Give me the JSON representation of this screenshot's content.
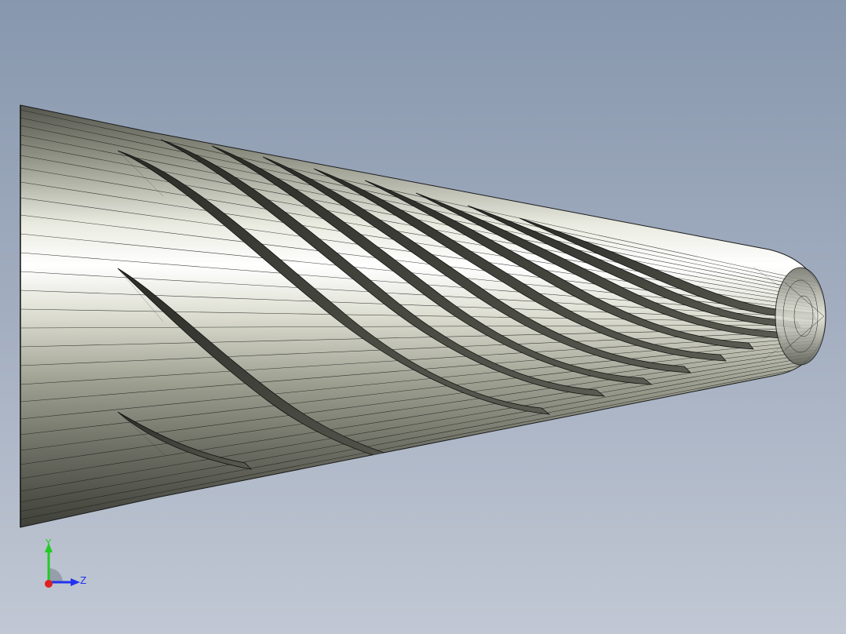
{
  "viewport": {
    "background_top": "#8797ad",
    "background_bottom": "#c1c8d4"
  },
  "model": {
    "render_style": "shaded-with-edges",
    "edge_color": "#1a1a1a",
    "body_light": "#ffffff",
    "body_mid": "#b8baa8",
    "body_dark": "#4a4c44"
  },
  "triad": {
    "y_label": "Y",
    "z_label": "Z",
    "y_color": "#22cc22",
    "z_color": "#2233ee",
    "x_color": "#dd2222"
  }
}
